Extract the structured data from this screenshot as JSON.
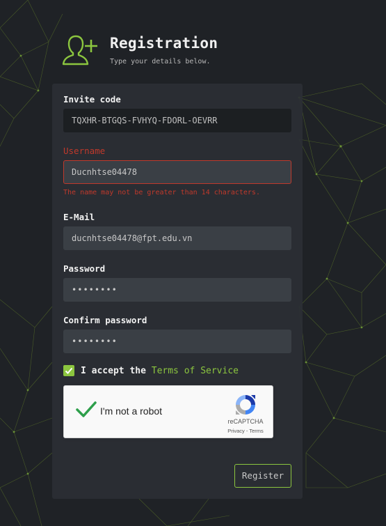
{
  "header": {
    "title": "Registration",
    "subtitle": "Type your details below."
  },
  "form": {
    "invite_code": {
      "label": "Invite code",
      "value": "TQXHR-BTGQS-FVHYQ-FDORL-OEVRR"
    },
    "username": {
      "label": "Username",
      "value": "Ducnhtse04478",
      "error": "The name may not be greater than 14 characters."
    },
    "email": {
      "label": "E-Mail",
      "value": "ducnhtse04478@fpt.edu.vn"
    },
    "password": {
      "label": "Password",
      "value": "••••••••"
    },
    "confirm_password": {
      "label": "Confirm password",
      "value": "••••••••"
    },
    "accept": {
      "prefix": "I accept the ",
      "link": "Terms of Service",
      "checked": true
    },
    "recaptcha": {
      "label": "I'm not a robot",
      "brand": "reCAPTCHA",
      "links": "Privacy - Terms",
      "checked": true
    },
    "register_label": "Register"
  },
  "colors": {
    "background": "#1f2226",
    "panel": "#2b2f34",
    "accent": "#8cc63f",
    "error": "#c0392b",
    "input": "#3a3f45"
  }
}
